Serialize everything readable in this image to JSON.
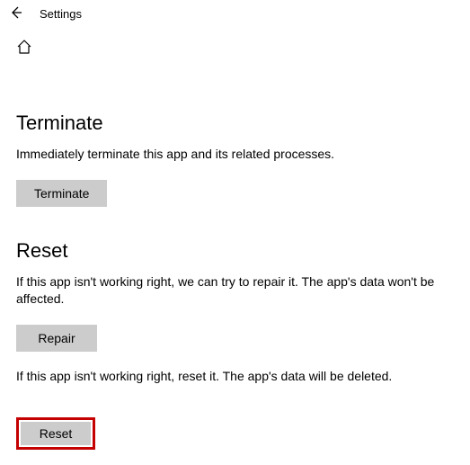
{
  "header": {
    "title": "Settings"
  },
  "sections": {
    "terminate": {
      "heading": "Terminate",
      "description": "Immediately terminate this app and its related processes.",
      "button_label": "Terminate"
    },
    "reset": {
      "heading": "Reset",
      "repair_description": "If this app isn't working right, we can try to repair it. The app's data won't be affected.",
      "repair_button_label": "Repair",
      "reset_description": "If this app isn't working right, reset it. The app's data will be deleted.",
      "reset_button_label": "Reset"
    }
  }
}
